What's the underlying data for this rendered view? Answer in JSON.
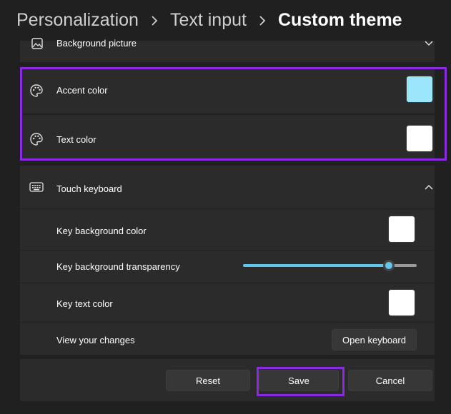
{
  "breadcrumb": {
    "items": [
      "Personalization",
      "Text input",
      "Custom theme"
    ]
  },
  "background_picture": {
    "label": "Background picture"
  },
  "accent_color": {
    "label": "Accent color",
    "value": "#9be6fb"
  },
  "text_color": {
    "label": "Text color",
    "value": "#ffffff"
  },
  "touch_keyboard": {
    "label": "Touch keyboard",
    "key_background_color": {
      "label": "Key background color",
      "value": "#ffffff"
    },
    "key_background_transparency": {
      "label": "Key background transparency",
      "value_fraction": 0.84
    },
    "key_text_color": {
      "label": "Key text color",
      "value": "#ffffff"
    },
    "view_changes": {
      "label": "View your changes",
      "button": "Open keyboard"
    }
  },
  "footer": {
    "reset": "Reset",
    "save": "Save",
    "cancel": "Cancel"
  },
  "colors": {
    "highlight": "#8a2be2",
    "slider_accent": "#5fc6ee"
  },
  "icons": {
    "background_picture": "image-icon",
    "accent_color": "palette-icon",
    "text_color": "palette-icon",
    "touch_keyboard": "keyboard-icon",
    "collapse": "chevron-down-icon",
    "expand": "chevron-up-icon"
  }
}
